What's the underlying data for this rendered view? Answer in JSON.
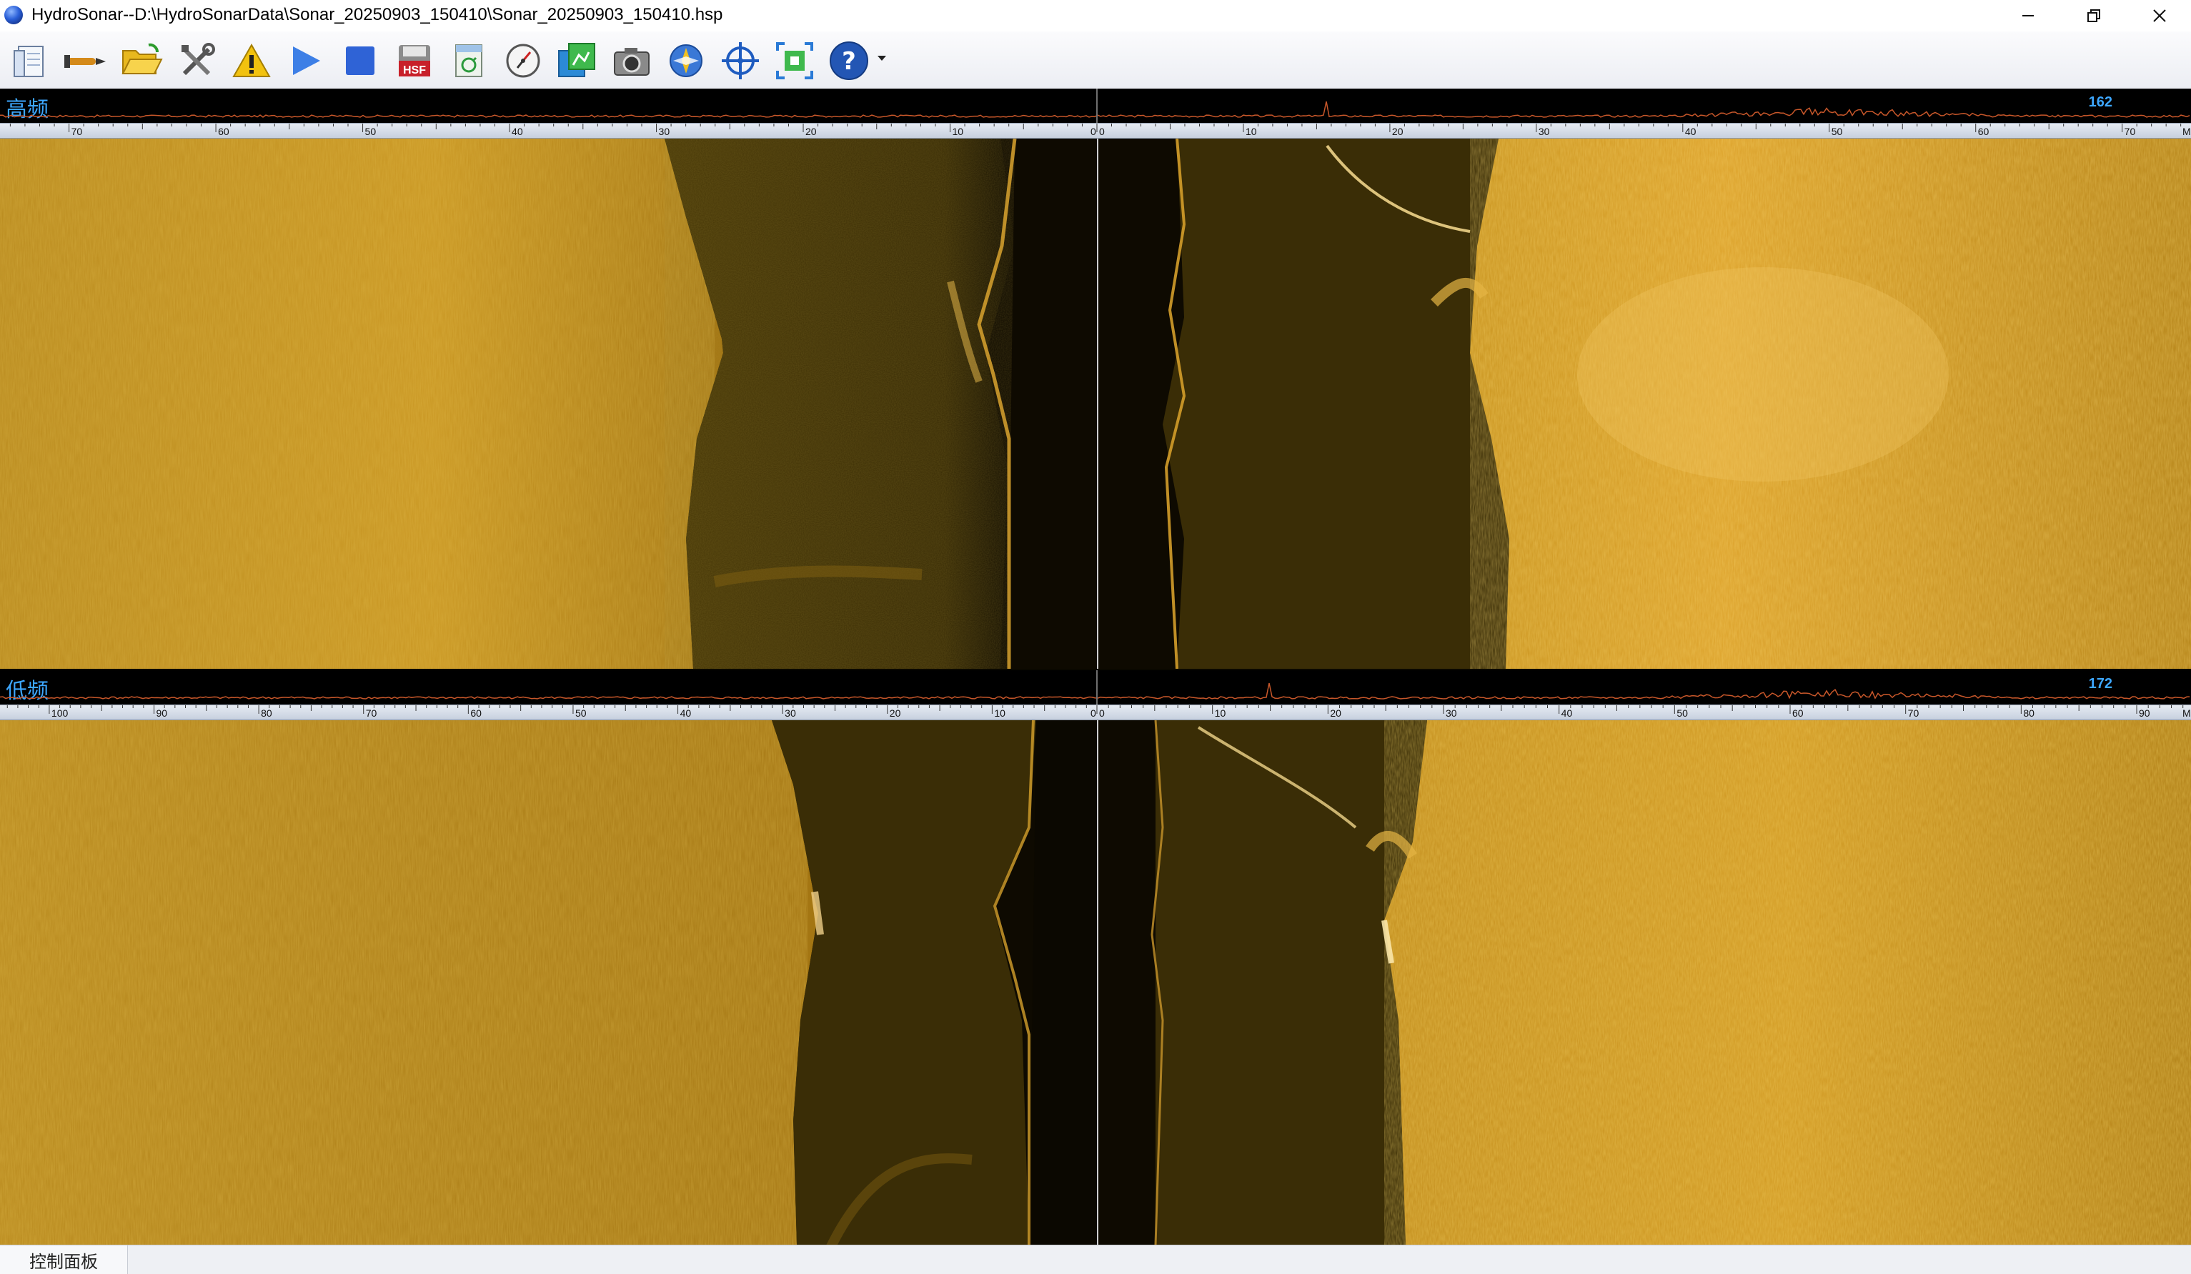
{
  "window": {
    "title": "HydroSonar--D:\\HydroSonarData\\Sonar_20250903_150410\\Sonar_20250903_150410.hsp",
    "controls": [
      "minimize-icon",
      "restore-icon",
      "close-icon"
    ]
  },
  "toolbar": {
    "buttons": [
      {
        "name": "new-file-button",
        "icon": "document-icon"
      },
      {
        "name": "torpedo-button",
        "icon": "torpedo-icon"
      },
      {
        "name": "open-folder-button",
        "icon": "folder-open-icon"
      },
      {
        "name": "settings-tools-button",
        "icon": "tools-icon"
      },
      {
        "name": "warning-button",
        "icon": "warning-icon"
      },
      {
        "name": "play-button",
        "icon": "play-icon"
      },
      {
        "name": "stop-button",
        "icon": "stop-icon"
      },
      {
        "name": "hsf-button",
        "icon": "hsf-icon",
        "label": "HSF"
      },
      {
        "name": "convert-xtf-button",
        "icon": "xtf-icon"
      },
      {
        "name": "compass-button",
        "icon": "compass-icon"
      },
      {
        "name": "map-overlay-button",
        "icon": "map-icon"
      },
      {
        "name": "camera-button",
        "icon": "camera-icon"
      },
      {
        "name": "navigation-button",
        "icon": "navigation-icon"
      },
      {
        "name": "target-button",
        "icon": "crosshair-icon"
      },
      {
        "name": "zoom-fit-button",
        "icon": "zoom-fit-icon"
      },
      {
        "name": "help-button",
        "icon": "help-icon"
      }
    ],
    "colors": {
      "play": "#3d7fe6",
      "stop": "#2f63d6",
      "hsf": "#c8202a",
      "help": "#2356b4",
      "warning": "#f2c20f"
    }
  },
  "panes": {
    "high": {
      "label": "高频",
      "value": "162",
      "left_ticks": [
        "70",
        "60",
        "50",
        "40",
        "30",
        "20",
        "10",
        "0"
      ],
      "right_ticks": [
        "0",
        "10",
        "20",
        "30",
        "40",
        "50",
        "60",
        "70"
      ],
      "right_end": "M"
    },
    "low": {
      "label": "低频",
      "value": "172",
      "left_ticks": [
        "100",
        "90",
        "80",
        "70",
        "60",
        "50",
        "40",
        "30",
        "20",
        "10",
        "0"
      ],
      "right_ticks": [
        "0",
        "10",
        "20",
        "30",
        "40",
        "50",
        "60",
        "70",
        "80",
        "90"
      ],
      "right_end": "M"
    }
  },
  "colors": {
    "sonar_bright": "#d9a52e",
    "sonar_dark": "#2b2205",
    "accent_label": "#3da7ff"
  },
  "status": {
    "control_panel_tab": "控制面板"
  }
}
